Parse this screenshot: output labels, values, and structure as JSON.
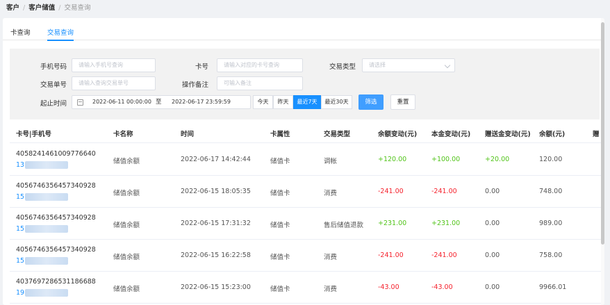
{
  "breadcrumb": {
    "items": [
      "客户",
      "客户储值",
      "交易查询"
    ],
    "separator": "/"
  },
  "tabs": [
    {
      "label": "卡查询",
      "active": false
    },
    {
      "label": "交易查询",
      "active": true
    }
  ],
  "filters": {
    "phone": {
      "label": "手机号码",
      "placeholder": "请输入手机号查询"
    },
    "card_no": {
      "label": "卡号",
      "placeholder": "请输入对应的卡号查询"
    },
    "trade_type": {
      "label": "交易类型",
      "placeholder": "请选择"
    },
    "trade_no": {
      "label": "交易单号",
      "placeholder": "请输入查询交易单号"
    },
    "remark": {
      "label": "操作备注",
      "placeholder": "可输入备注"
    },
    "date_range": {
      "label": "起止时间",
      "start": "2022-06-11 00:00:00",
      "separator": "至",
      "end": "2022-06-17 23:59:59"
    },
    "quick": [
      {
        "label": "今天",
        "active": false
      },
      {
        "label": "昨天",
        "active": false
      },
      {
        "label": "最近7天",
        "active": true
      },
      {
        "label": "最近30天",
        "active": false
      }
    ],
    "filter_button": "筛选",
    "reset_button": "重置"
  },
  "table": {
    "columns": [
      "卡号|手机号",
      "卡名称",
      "时间",
      "卡属性",
      "交易类型",
      "余额变动(元)",
      "本金变动(元)",
      "赠送金变动(元)",
      "余额(元)",
      "赠"
    ],
    "rows": [
      {
        "card_no": "4058241461009776640",
        "phone": "13",
        "card_name": "储值余额",
        "time": "2022-06-17 14:42:44",
        "attr": "储值卡",
        "type": "调帐",
        "balance_change": "+120.00",
        "principal_change": "+100.00",
        "gift_change": "+20.00",
        "balance": "120.00"
      },
      {
        "card_no": "4056746356457340928",
        "phone": "15",
        "card_name": "储值余额",
        "time": "2022-06-15 18:05:35",
        "attr": "储值卡",
        "type": "消费",
        "balance_change": "-241.00",
        "principal_change": "-241.00",
        "gift_change": "0.00",
        "balance": "748.00"
      },
      {
        "card_no": "4056746356457340928",
        "phone": "15",
        "card_name": "储值余额",
        "time": "2022-06-15 17:31:32",
        "attr": "储值卡",
        "type": "售后储值退款",
        "balance_change": "+231.00",
        "principal_change": "+231.00",
        "gift_change": "0.00",
        "balance": "989.00"
      },
      {
        "card_no": "4056746356457340928",
        "phone": "15",
        "card_name": "储值余额",
        "time": "2022-06-15 16:22:58",
        "attr": "储值卡",
        "type": "消费",
        "balance_change": "-241.00",
        "principal_change": "-241.00",
        "gift_change": "0.00",
        "balance": "758.00"
      },
      {
        "card_no": "4037697286531186688",
        "phone": "19",
        "card_name": "储值余额",
        "time": "2022-06-15 15:23:00",
        "attr": "储值卡",
        "type": "消费",
        "balance_change": "-43.00",
        "principal_change": "-43.00",
        "gift_change": "0.00",
        "balance": "9966.01"
      }
    ]
  },
  "colors": {
    "accent": "#1890ff",
    "positive": "#52c41a",
    "negative": "#f5222d"
  }
}
